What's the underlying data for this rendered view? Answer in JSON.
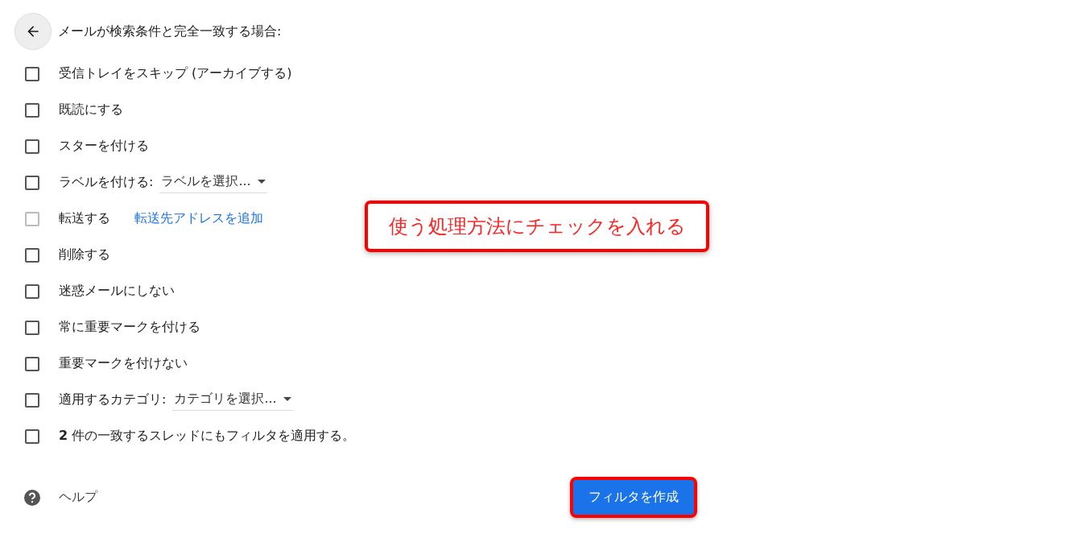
{
  "header": {
    "title": "メールが検索条件と完全一致する場合:"
  },
  "actions": [
    {
      "kind": "plain",
      "label": "受信トレイをスキップ (アーカイブする)",
      "checked": false,
      "disabled": false
    },
    {
      "kind": "plain",
      "label": "既読にする",
      "checked": false,
      "disabled": false
    },
    {
      "kind": "plain",
      "label": "スターを付ける",
      "checked": false,
      "disabled": false
    },
    {
      "kind": "dropdown",
      "label": "ラベルを付ける:",
      "value": "ラベルを選択...",
      "checked": false,
      "disabled": false
    },
    {
      "kind": "link",
      "label": "転送する",
      "link": "転送先アドレスを追加",
      "checked": false,
      "disabled": true
    },
    {
      "kind": "plain",
      "label": "削除する",
      "checked": false,
      "disabled": false
    },
    {
      "kind": "plain",
      "label": "迷惑メールにしない",
      "checked": false,
      "disabled": false
    },
    {
      "kind": "plain",
      "label": "常に重要マークを付ける",
      "checked": false,
      "disabled": false
    },
    {
      "kind": "plain",
      "label": "重要マークを付けない",
      "checked": false,
      "disabled": false
    },
    {
      "kind": "dropdown",
      "label": "適用するカテゴリ:",
      "value": "カテゴリを選択...",
      "checked": false,
      "disabled": false
    },
    {
      "kind": "plain",
      "label": "**2** 件の一致するスレッドにもフィルタを適用する。",
      "checked": false,
      "disabled": false
    }
  ],
  "help": {
    "label": "ヘルプ"
  },
  "create_button": {
    "label": "フィルタを作成",
    "highlighted": true
  },
  "annotation": {
    "text": "使う処理方法にチェックを入れる"
  }
}
